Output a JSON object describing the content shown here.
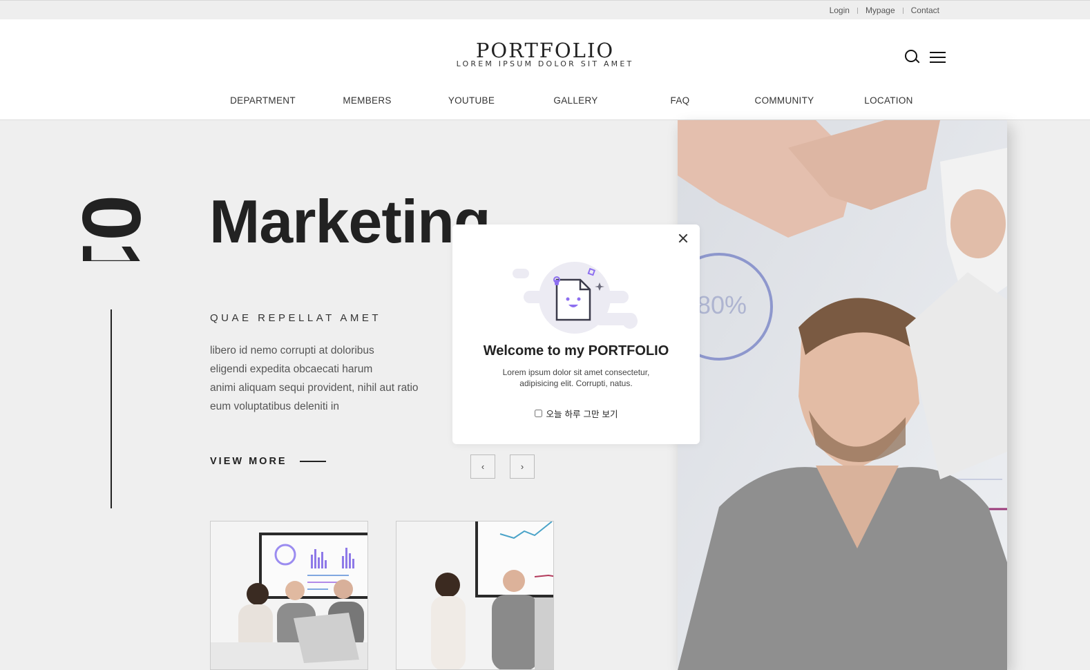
{
  "topbar": {
    "login": "Login",
    "mypage": "Mypage",
    "contact": "Contact"
  },
  "header": {
    "logo_title": "PORTFOLIO",
    "logo_sub": "LOREM IPSUM DOLOR SIT AMET",
    "icons": [
      "search-icon",
      "menu-icon"
    ],
    "nav": [
      "DEPARTMENT",
      "MEMBERS",
      "YOUTUBE",
      "GALLERY",
      "FAQ",
      "COMMUNITY",
      "LOCATION"
    ]
  },
  "hero": {
    "number": "01",
    "title": "Marketing",
    "kicker": "QUAE REPELLAT AMET",
    "desc": [
      "libero id nemo corrupti at doloribus",
      "eligendi expedita obcaecati harum",
      "animi aliquam sequi provident, nihil aut ratio",
      "eum voluptatibus deleniti in"
    ],
    "view_more": "VIEW MORE",
    "prev": "‹",
    "next": "›"
  },
  "modal": {
    "title": "Welcome to my PORTFOLIO",
    "text_line1": "Lorem ipsum dolor sit amet consectetur,",
    "text_line2": "adipisicing elit. Corrupti, natus.",
    "checkbox_label": "오늘 하루 그만 보기",
    "icons": [
      "close-icon",
      "document-smile-icon"
    ]
  },
  "colors": {
    "accent": "#8d6ff0",
    "background": "#efefef",
    "text": "#222222"
  }
}
